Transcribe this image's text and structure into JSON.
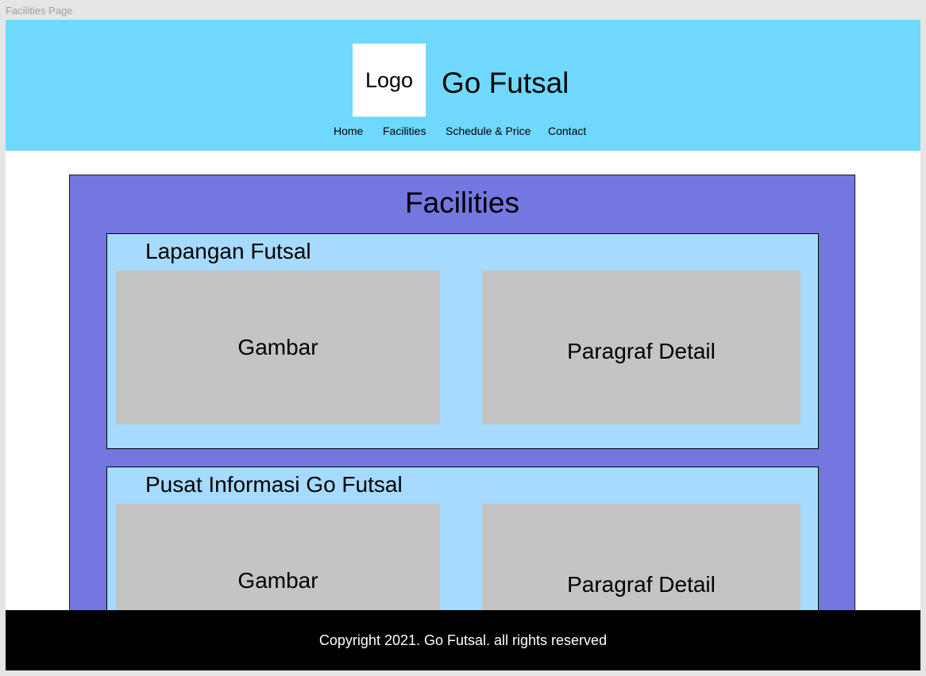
{
  "canvas": {
    "frame_label": "Facilities Page"
  },
  "header": {
    "logo_label": "Logo",
    "site_title": "Go Futsal",
    "background_color": "#70d8fc",
    "nav": [
      {
        "label": "Home"
      },
      {
        "label": "Facilities"
      },
      {
        "label": "Schedule & Price"
      },
      {
        "label": "Contact"
      }
    ]
  },
  "main": {
    "title": "Facilities",
    "background_color": "#7477e0",
    "cards": [
      {
        "title": "Lapangan Futsal",
        "image_label": "Gambar",
        "detail_label": "Paragraf Detail"
      },
      {
        "title": "Pusat Informasi Go Futsal",
        "image_label": "Gambar",
        "detail_label": "Paragraf Detail"
      }
    ]
  },
  "footer": {
    "copyright": "Copyright 2021. Go Futsal. all rights reserved",
    "background_color": "#000000"
  }
}
